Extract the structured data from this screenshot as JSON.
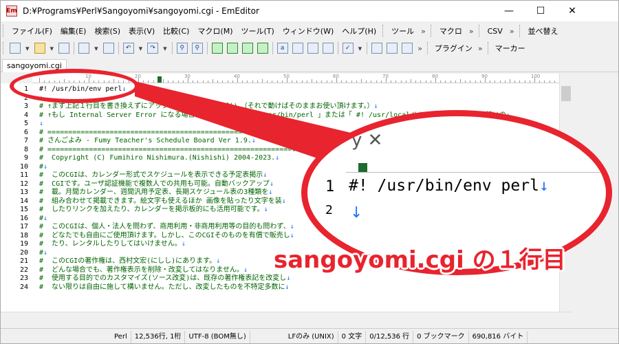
{
  "window": {
    "title": "D:¥Programs¥Perl¥Sangoyomi¥sangoyomi.cgi - EmEditor",
    "app_icon_label": "Em",
    "minimize": "—",
    "maximize": "☐",
    "close": "✕"
  },
  "menu": {
    "items": [
      "ファイル(F)",
      "編集(E)",
      "検索(S)",
      "表示(V)",
      "比較(C)",
      "マクロ(M)",
      "ツール(T)",
      "ウィンドウ(W)",
      "ヘルプ(H)"
    ],
    "right_bars": [
      "ツール",
      "マクロ",
      "CSV",
      "並べ替え"
    ]
  },
  "toolbar": {
    "right_bars": [
      "プラグイン",
      "マーカー"
    ]
  },
  "tab": {
    "label": "sangoyomi.cgi"
  },
  "ruler": {
    "labels": [
      "10",
      "20",
      "30",
      "40",
      "50",
      "60",
      "70",
      "80",
      "90",
      "100"
    ]
  },
  "editor": {
    "line_numbers": [
      "1",
      "2",
      "3",
      "4",
      "5",
      "6",
      "7",
      "8",
      "9",
      "10",
      "11",
      "12",
      "13",
      "14",
      "15",
      "16",
      "17",
      "18",
      "19",
      "20",
      "21",
      "22",
      "23",
      "24"
    ],
    "lines": [
      "#! /usr/bin/env perl",
      "",
      "# ↑まず上記１行目を書き換えずにアップロードしてみて下さい。（それで動けばそのままお使い頂けます。）",
      "# ↑もし Internal Server Error になる場合は、１行目を「 #! /usr/bin/perl 」または「 #! /usr/local/bin/perl 」など、お使いの",
      "",
      "# ===========================================================",
      "# さんごよみ - Fumy Teacher's Schedule Board Ver 1.9.",
      "# ===========================================================",
      "#  Copyright (C) Fumihiro Nishimura.(Nishishi) 2004-2023.",
      "#",
      "#  このCGIは、カレンダー形式でスケジュールを表示できる予定表掲示",
      "#  CGIです。ユーザ認証機能で複数人での共用も可能。自動バックアップ",
      "#  載。月間カレンダー、週間汎用予定表、長期スケジュール表の3種類を",
      "#  組み合わせて掲載できます。絵文字も使えるほか 画像を貼ったり文字を装",
      "#  したりリンクを加えたり、カレンダーを掲示板的にも活用可能です。",
      "#",
      "#  このCGIは、個人・法人を問わず、商用利用・非商用利用等の目的も問わず、",
      "#  どなたでも自由にご使用頂けます。しかし、このCGIそのものを有償で販売し",
      "#  たり、レンタルしたりしてはいけません。",
      "#",
      "#  このCGIの著作権は、西村文宏(にしし)にあります。",
      "#  どんな場合でも、著作権表示を削除・改変してはなりません。",
      "#  使用する目的でのカスタマイズ(ソース改変)は、既存の著作権表記を改変し",
      "#  ない限りは自由に施して構いません。ただし、改変したものを不特定多数に"
    ],
    "lf_mark": "↓"
  },
  "zoom": {
    "tab_fragment": "y ✕",
    "line1_number": "1",
    "line1_text": "#! /usr/bin/env perl",
    "line2_number": "2",
    "line2_text": "↓"
  },
  "caption": "sangoyomi.cgi の１行目",
  "status": {
    "items": [
      "Perl",
      "12,536行, 1桁",
      "UTF-8 (BOM無し)",
      "LFのみ (UNIX)",
      "0 文字",
      "0/12,536 行",
      "0 ブックマーク",
      "690,816 バイト"
    ]
  },
  "colors": {
    "accent": "#e8242e",
    "comment": "#006400",
    "lf": "#1e6fff",
    "ruler_marker": "#1e6b2e"
  }
}
